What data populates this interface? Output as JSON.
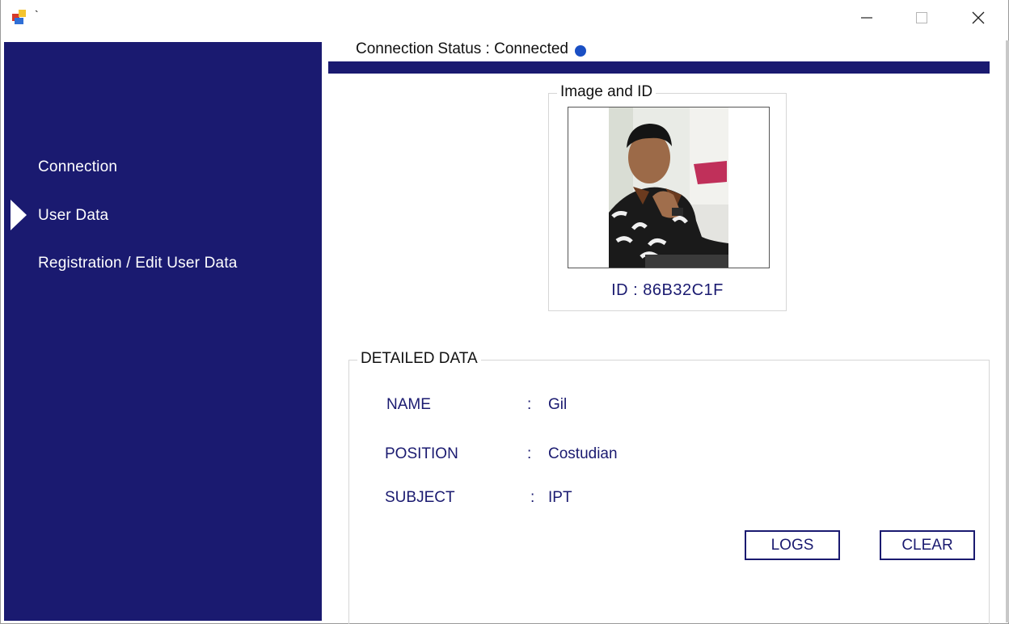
{
  "window": {
    "title": "`",
    "controls": {
      "minimize": "minimize-icon",
      "maximize": "maximize-icon",
      "close": "close-icon"
    }
  },
  "sidebar": {
    "items": [
      {
        "label": "Connection",
        "active": false
      },
      {
        "label": "User Data",
        "active": true
      },
      {
        "label": "Registration / Edit User Data",
        "active": false
      }
    ],
    "background": "#1a1a70"
  },
  "header": {
    "connection_status": "Connection Status : Connected",
    "status_dot_color": "#1a4fc4"
  },
  "image_group": {
    "legend": "Image and ID",
    "id_text": "ID : 86B32C1F"
  },
  "detail_group": {
    "legend": "DETAILED DATA",
    "rows": [
      {
        "label": "NAME",
        "colon": ":",
        "value": "Gil"
      },
      {
        "label": "POSITION",
        "colon": ":",
        "value": "Costudian"
      },
      {
        "label": "SUBJECT",
        "colon": ":",
        "value": "IPT"
      }
    ]
  },
  "buttons": {
    "logs": "LOGS",
    "clear": "CLEAR"
  },
  "colors": {
    "accent": "#1a1a70",
    "text_dark": "#111111",
    "white": "#ffffff"
  }
}
